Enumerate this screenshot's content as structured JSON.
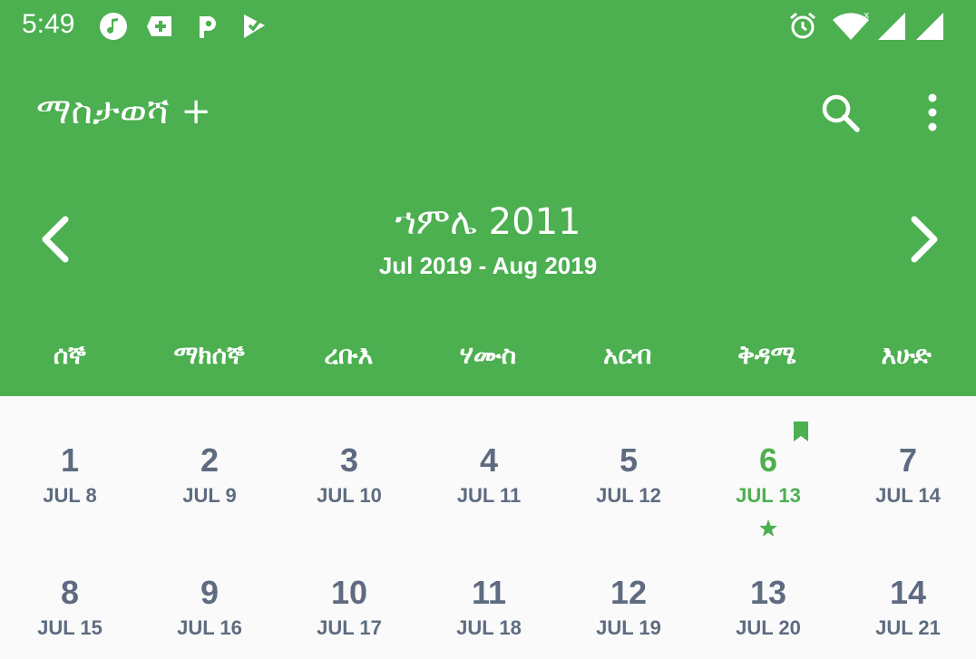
{
  "status_bar": {
    "time": "5:49",
    "left_icons": [
      "music-note-icon",
      "add-app-icon",
      "p-app-icon",
      "check-app-icon"
    ],
    "right_icons": [
      "alarm-icon",
      "wifi-icon",
      "signal-icon",
      "signal-icon"
    ],
    "icon_color": "#ffffff"
  },
  "app_bar": {
    "title": "ማስታወሻ +",
    "actions": [
      "search-icon",
      "more-vert-icon"
    ]
  },
  "month_nav": {
    "title": "ኀምሌ 2011",
    "range": "Jul 2019 - Aug 2019",
    "prev_icon": "chevron-left-icon",
    "next_icon": "chevron-right-icon"
  },
  "weekdays": [
    "ሰኞ",
    "ማክሰኞ",
    "ረቡእ",
    "ሃሙስ",
    "አርብ",
    "ቅዳሜ",
    "እሁድ"
  ],
  "days": [
    {
      "num": "1",
      "greg": "JUL 8"
    },
    {
      "num": "2",
      "greg": "JUL 9"
    },
    {
      "num": "3",
      "greg": "JUL 10"
    },
    {
      "num": "4",
      "greg": "JUL 11"
    },
    {
      "num": "5",
      "greg": "JUL 12"
    },
    {
      "num": "6",
      "greg": "JUL 13",
      "today": true,
      "bookmark": true,
      "star": true
    },
    {
      "num": "7",
      "greg": "JUL 14"
    },
    {
      "num": "8",
      "greg": "JUL 15"
    },
    {
      "num": "9",
      "greg": "JUL 16"
    },
    {
      "num": "10",
      "greg": "JUL 17"
    },
    {
      "num": "11",
      "greg": "JUL 18"
    },
    {
      "num": "12",
      "greg": "JUL 19"
    },
    {
      "num": "13",
      "greg": "JUL 20"
    },
    {
      "num": "14",
      "greg": "JUL 21"
    }
  ],
  "colors": {
    "primary": "#4caf50",
    "day_text": "#5e6b80",
    "background": "#fafafa"
  }
}
